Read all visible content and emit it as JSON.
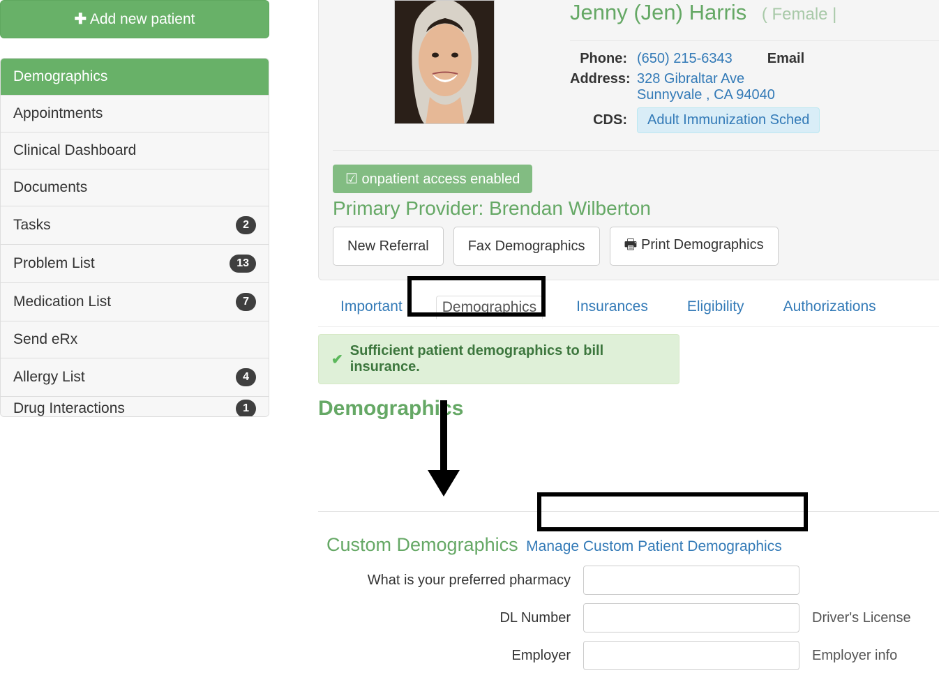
{
  "sidebar": {
    "add_button": "Add new patient",
    "items": [
      {
        "label": "Demographics",
        "badge": null,
        "active": true
      },
      {
        "label": "Appointments",
        "badge": null
      },
      {
        "label": "Clinical Dashboard",
        "badge": null
      },
      {
        "label": "Documents",
        "badge": null
      },
      {
        "label": "Tasks",
        "badge": "2"
      },
      {
        "label": "Problem List",
        "badge": "13"
      },
      {
        "label": "Medication List",
        "badge": "7"
      },
      {
        "label": "Send eRx",
        "badge": null
      },
      {
        "label": "Allergy List",
        "badge": "4"
      },
      {
        "label": "Drug Interactions",
        "badge": "1"
      }
    ]
  },
  "patient": {
    "name": "Jenny (Jen) Harris",
    "gender": "Female",
    "phone_label": "Phone:",
    "phone": "(650) 215-6343",
    "email_label": "Email",
    "address_label": "Address:",
    "address_line1": "328 Gibraltar Ave",
    "address_line2": "Sunnyvale , CA 94040",
    "cds_label": "CDS:",
    "cds_value": "Adult Immunization Sched",
    "onpatient_badge": "onpatient access enabled",
    "primary_provider_label": "Primary Provider: ",
    "primary_provider_name": "Brendan Wilberton",
    "btn_referral": "New Referral",
    "btn_fax": "Fax Demographics",
    "btn_print": "Print Demographics"
  },
  "tabs": [
    {
      "label": "Important"
    },
    {
      "label": "Demographics",
      "active": true
    },
    {
      "label": "Insurances"
    },
    {
      "label": "Eligibility"
    },
    {
      "label": "Authorizations"
    }
  ],
  "alert": "Sufficient patient demographics to bill insurance.",
  "section": {
    "title": "Demographics",
    "custom_title": "Custom Demographics",
    "manage_link": "Manage Custom Patient Demographics"
  },
  "custom_fields": [
    {
      "label": "What is your preferred pharmacy",
      "help": "",
      "value": ""
    },
    {
      "label": "DL Number",
      "help": "Driver's License",
      "value": ""
    },
    {
      "label": "Employer",
      "help": "Employer info",
      "value": ""
    }
  ]
}
